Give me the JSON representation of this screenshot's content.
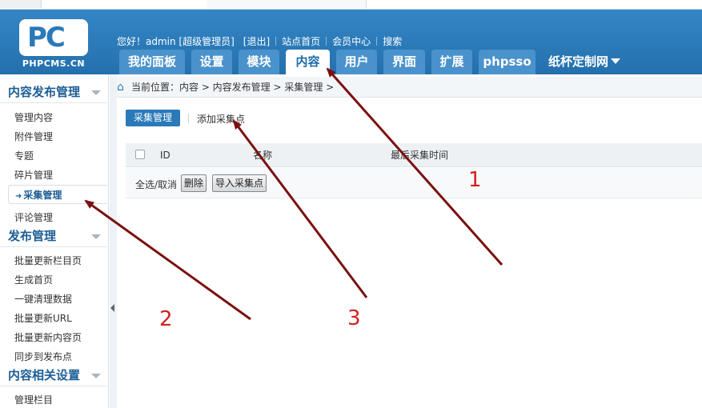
{
  "header": {
    "logo_mark": "PC",
    "logo_text": "PHPCMS.CN",
    "greeting": "您好！admin [超级管理员]",
    "links": [
      "[退出]",
      "站点首页",
      "会员中心",
      "搜索"
    ]
  },
  "nav": {
    "tabs": [
      "我的面板",
      "设置",
      "模块",
      "内容",
      "用户",
      "界面",
      "扩展",
      "phpsso"
    ],
    "active": "内容",
    "site_select": "纸杯定制网"
  },
  "sidebar": {
    "groups": [
      {
        "title": "内容发布管理",
        "items": [
          "管理内容",
          "附件管理",
          "专题",
          "碎片管理",
          "采集管理",
          "评论管理"
        ]
      },
      {
        "title": "发布管理",
        "items": [
          "批量更新栏目页",
          "生成首页",
          "一键清理数据",
          "批量更新URL",
          "批量更新内容页",
          "同步到发布点"
        ]
      },
      {
        "title": "内容相关设置",
        "items": [
          "管理栏目"
        ]
      }
    ],
    "selected": "采集管理"
  },
  "breadcrumb": {
    "text": "当前位置：内容 > 内容发布管理 > 采集管理 >"
  },
  "toolbar": {
    "primary": "采集管理",
    "link": "添加采集点"
  },
  "table": {
    "columns": [
      "ID",
      "名称",
      "最后采集时间"
    ],
    "select_label": "全选/取消",
    "delete_button": "删除",
    "import_button": "导入采集点"
  },
  "annotations": [
    "1",
    "2",
    "3"
  ],
  "colors": {
    "header_blue": "#2a79b8",
    "annotation_red": "#d42020",
    "arrow_color": "#7a1010"
  }
}
